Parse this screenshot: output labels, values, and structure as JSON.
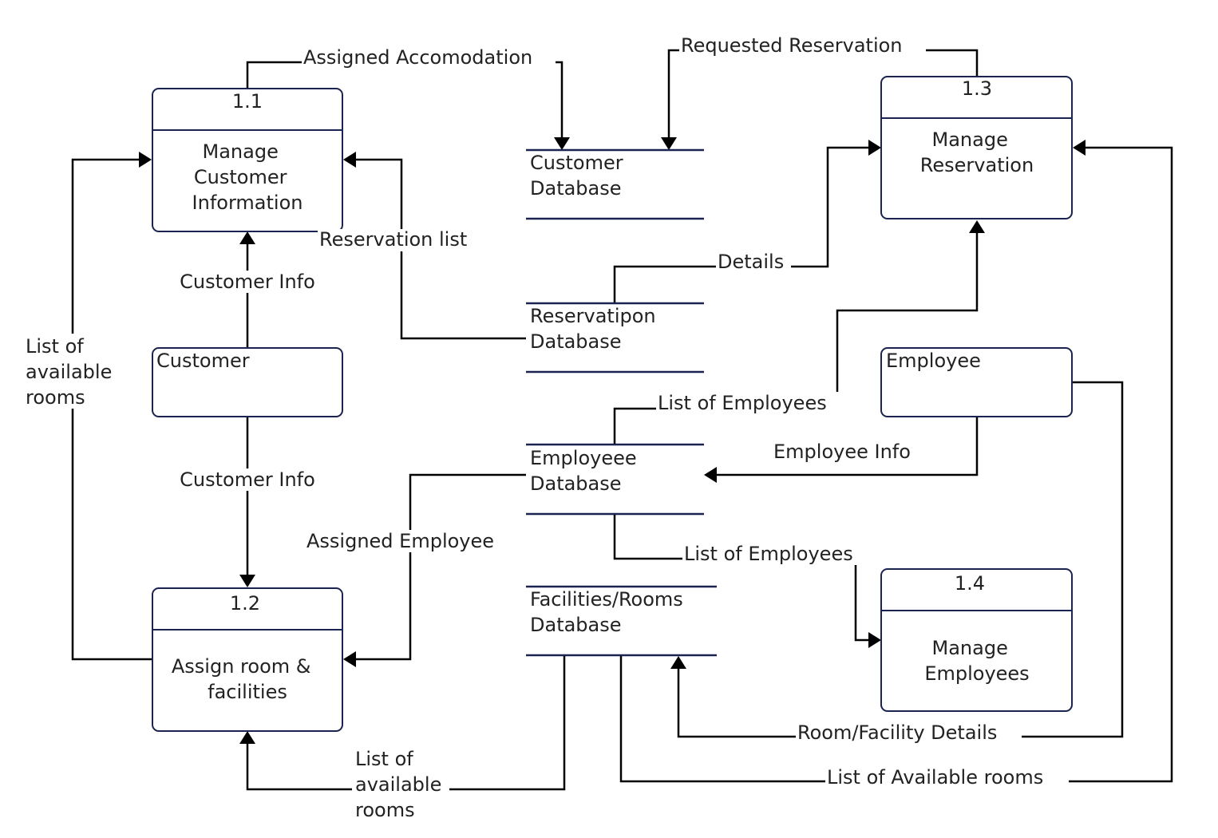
{
  "diagram": {
    "type": "data-flow-diagram",
    "colors": {
      "shape_stroke": "#1b2350",
      "connector": "#000000",
      "text": "#222222",
      "background": "#ffffff"
    },
    "processes": [
      {
        "id": "p11",
        "number": "1.1",
        "lines": [
          "Manage",
          "Customer",
          "Information"
        ]
      },
      {
        "id": "p12",
        "number": "1.2",
        "lines": [
          "Assign room &",
          "facilities"
        ]
      },
      {
        "id": "p13",
        "number": "1.3",
        "lines": [
          "Manage",
          "Reservation"
        ]
      },
      {
        "id": "p14",
        "number": "1.4",
        "lines": [
          "Manage",
          "Employees"
        ]
      }
    ],
    "entities": [
      {
        "id": "customer",
        "label": "Customer"
      },
      {
        "id": "employee",
        "label": "Employee"
      }
    ],
    "stores": [
      {
        "id": "customer_db",
        "lines": [
          "Customer",
          "Database"
        ]
      },
      {
        "id": "reservation_db",
        "lines": [
          "Reservatipon",
          "Database"
        ]
      },
      {
        "id": "employee_db",
        "lines": [
          "Employeee",
          "Database"
        ]
      },
      {
        "id": "facilities_db",
        "lines": [
          "Facilities/Rooms",
          "Database"
        ]
      }
    ],
    "flows": [
      {
        "id": "f1",
        "from": "p11",
        "to": "customer_db",
        "label": [
          "Assigned Accomodation"
        ]
      },
      {
        "id": "f2",
        "from": "p13",
        "to": "customer_db",
        "label": [
          "Requested Reservation"
        ]
      },
      {
        "id": "f3",
        "from": "reservation_db",
        "to": "p11",
        "label": [
          "Reservation list"
        ]
      },
      {
        "id": "f4",
        "from": "customer",
        "to": "p11",
        "label": [
          "Customer Info"
        ]
      },
      {
        "id": "f5",
        "from": "customer",
        "to": "p12",
        "label": [
          "Customer Info"
        ]
      },
      {
        "id": "f6",
        "from": "p12",
        "to": "p11",
        "label": [
          "List of",
          "available",
          "rooms"
        ]
      },
      {
        "id": "f7",
        "from": "reservation_db",
        "to": "p13",
        "label": [
          "Details"
        ]
      },
      {
        "id": "f8",
        "from": "employee_db",
        "to": "p13",
        "label": [
          "List of Employees"
        ]
      },
      {
        "id": "f9",
        "from": "employee",
        "to": "employee_db",
        "label": [
          "Employee Info"
        ]
      },
      {
        "id": "f10",
        "from": "employee_db",
        "to": "p12",
        "label": [
          "Assigned Employee"
        ]
      },
      {
        "id": "f11",
        "from": "employee_db",
        "to": "p14",
        "label": [
          "List of Employees"
        ]
      },
      {
        "id": "f12",
        "from": "facilities_db",
        "to": "p12",
        "label": [
          "List of",
          "available",
          "rooms"
        ]
      },
      {
        "id": "f13",
        "from": "employee",
        "to": "facilities_db",
        "label": [
          "Room/Facility Details"
        ]
      },
      {
        "id": "f14",
        "from": "facilities_db",
        "to": "p13",
        "label": [
          "List of Available rooms"
        ]
      }
    ]
  }
}
